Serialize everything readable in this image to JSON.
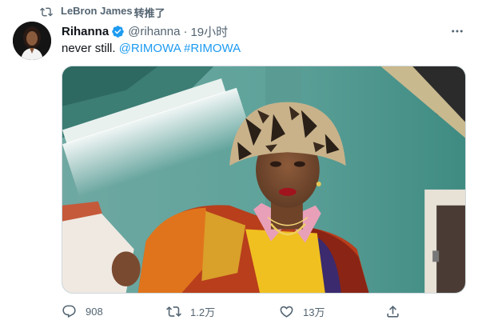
{
  "retweet": {
    "user": "LeBron James",
    "suffix": "转推了"
  },
  "tweet": {
    "author_name": "Rihanna",
    "handle": "@rihanna",
    "separator": "·",
    "time": "19小时",
    "text_plain": "never still. ",
    "mention": "@RIMOWA",
    "hashtag": "#RIMOWA"
  },
  "stats": {
    "replies": "908",
    "retweets": "1.2万",
    "likes": "13万"
  },
  "colors": {
    "link": "#1d9bf0",
    "muted": "#536471",
    "verified": "#1d9bf0",
    "text": "#0f1419"
  },
  "icons": {
    "retweet_banner": "retweet-icon",
    "verified": "verified-badge-icon",
    "more": "more-options-icon",
    "reply": "reply-icon",
    "retweet": "retweet-icon",
    "like": "like-icon",
    "share": "share-icon"
  }
}
